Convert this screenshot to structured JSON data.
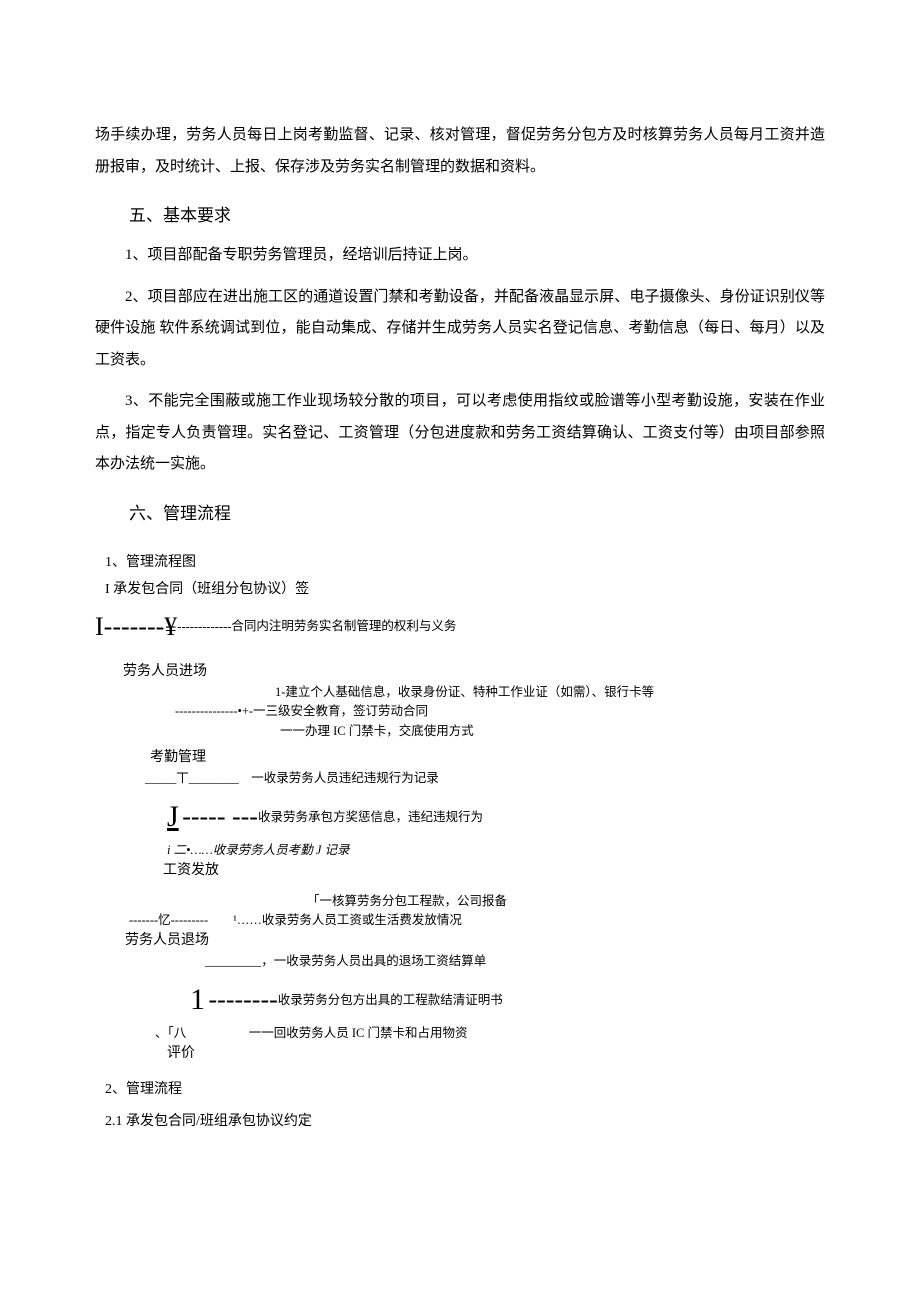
{
  "para_top": "场手续办理，劳务人员每日上岗考勤监督、记录、核对管理，督促劳务分包方及时核算劳务人员每月工资并造册报审，及时统计、上报、保存涉及劳务实名制管理的数据和资料。",
  "heading5": "五、基本要求",
  "req1": "1、项目部配备专职劳务管理员，经培训后持证上岗。",
  "req2": "2、项目部应在进出施工区的通道设置门禁和考勤设备，并配备液晶显示屏、电子摄像头、身份证识别仪等硬件设施 软件系统调试到位，能自动集成、存储并生成劳务人员实名登记信息、考勤信息（每日、每月）以及工资表。",
  "req3": "3、不能完全围蔽或施工作业现场较分散的项目，可以考虑使用指纹或脸谱等小型考勤设施，安装在作业点，指定专人负责管理。实名登记、工资管理（分包进度款和劳务工资结算确认、工资支付等）由项目部参照本办法统一实施。",
  "heading6": "六、管理流程",
  "flow": {
    "h1": "1、管理流程图",
    "step1": "I 承发包合同（班组分包协议）签",
    "step1_note": "合同内注明劳务实名制管理的权利与义务",
    "step2": "劳务人员进场",
    "step2_note1": "1-建立个人基础信息，收录身份证、特种工作业证（如需）、银行卡等",
    "step2_note2": "一三级安全教育，签订劳动合同",
    "step2_note3": "一一办理 IC 门禁卡，交底使用方式",
    "step3": "考勤管理",
    "step3_note": "一收录劳务人员违纪违规行为记录",
    "step3_note2": "收录劳务承包方奖惩信息，违纪违规行为",
    "step3_note3": "i 二•……收录劳务人员考勤 J 记录",
    "step4": "工资发放",
    "step4_note1": "「一核算劳务分包工程款，公司报备",
    "step4_note2": "¹……收录劳务人员工资或生活费发放情况",
    "step5": "劳务人员退场",
    "step5_note1": "，一收录劳务人员出具的退场工资结算单",
    "step5_note2": "收录劳务分包方出具的工程款结清证明书",
    "step5_note3": "一一回收劳务人员 IC 门禁卡和占用物资",
    "step6": "评价",
    "h2": "2、管理流程",
    "h21": "2.1 承发包合同/班组承包协议约定"
  }
}
